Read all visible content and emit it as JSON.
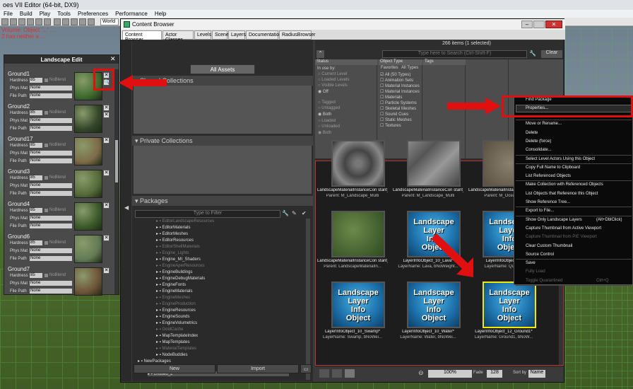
{
  "window": {
    "title": "oes VII Editor (64-bit, DX9)"
  },
  "menubar": [
    "File",
    "Build",
    "Play",
    "Tools",
    "Preferences",
    "Performance",
    "Help"
  ],
  "toolbar": {
    "world": "World"
  },
  "bg_errors": [
    "Volume: Object '...' ...",
    "2 has neither a ..."
  ],
  "landscape": {
    "title": "Landscape Edit",
    "layers": [
      {
        "name": "Ground1",
        "hardness": "85",
        "noblend": "NoBlend",
        "physmat": "None",
        "filepath": "None"
      },
      {
        "name": "Ground2",
        "hardness": "85",
        "noblend": "NoBlend",
        "physmat": "None",
        "filepath": "None"
      },
      {
        "name": "Ground17",
        "hardness": "85",
        "noblend": "NoBlend",
        "physmat": "None",
        "filepath": "None"
      },
      {
        "name": "Ground3",
        "hardness": "85",
        "noblend": "NoBlend",
        "physmat": "None",
        "filepath": "None"
      },
      {
        "name": "Ground4",
        "hardness": "85",
        "noblend": "NoBlend",
        "physmat": "None",
        "filepath": "None"
      },
      {
        "name": "Ground6",
        "hardness": "85",
        "noblend": "NoBlend",
        "physmat": "None",
        "filepath": "None"
      },
      {
        "name": "Ground7",
        "hardness": "85",
        "noblend": "NoBlend",
        "physmat": "None",
        "filepath": "None"
      }
    ],
    "labels": {
      "hardness": "Hardness",
      "physmat": "Phys Mat",
      "filepath": "File Path"
    }
  },
  "browser": {
    "title": "Content Browser",
    "tabs": [
      "Content Browser",
      "Actor Classes",
      "Levels",
      "Scene",
      "Layers",
      "Documentation",
      "RadiusBrowser"
    ],
    "all_assets": "All Assets",
    "shared": "Shared Collections",
    "private": "Private Collections",
    "packages": "Packages",
    "pkg_filter": "Type to Filter",
    "items_count": "266 items (1 selected)",
    "search_placeholder": "Type here to Search (Ctrl-Shift-F)",
    "clear": "Clear",
    "new": "New",
    "import": "Import",
    "zoom": "100%",
    "thumb_size": "128",
    "sort_by": "Sort by",
    "sort_value": "Name",
    "fade": "Fade"
  },
  "packages": [
    {
      "name": "EditorLandscapeResources",
      "dim": true
    },
    {
      "name": "EditorMaterials",
      "dim": false
    },
    {
      "name": "EditorMeshes",
      "dim": false
    },
    {
      "name": "EditorResources",
      "dim": false
    },
    {
      "name": "EditorShellMaterials",
      "dim": true
    },
    {
      "name": "Engine_Lights",
      "dim": true
    },
    {
      "name": "Engine_MI_Shaders",
      "dim": false
    },
    {
      "name": "EngineAperResources",
      "dim": true
    },
    {
      "name": "EngineBuildings",
      "dim": false
    },
    {
      "name": "EngineDebugMaterials",
      "dim": false
    },
    {
      "name": "EngineFonts",
      "dim": false
    },
    {
      "name": "EngineMaterials",
      "dim": false
    },
    {
      "name": "EngineMeshes",
      "dim": true
    },
    {
      "name": "EngineProduction",
      "dim": true
    },
    {
      "name": "EngineResources",
      "dim": false
    },
    {
      "name": "EngineSounds",
      "dim": false
    },
    {
      "name": "EngineVolumetrics",
      "dim": false
    },
    {
      "name": "GoldCache",
      "dim": true
    },
    {
      "name": "MapTemplateIndex",
      "dim": false
    },
    {
      "name": "MapTemplates",
      "dim": false
    },
    {
      "name": "MaterialTemplates",
      "dim": true
    },
    {
      "name": "NodeBuddies",
      "dim": false
    },
    {
      "name": "NewPackages",
      "dim": false
    },
    {
      "name": "Untitled_1",
      "dim": false
    },
    {
      "name": "Untitled_2*",
      "dim": false
    }
  ],
  "filters": {
    "status_hdr": "Status",
    "inuse": "In use by:",
    "status": [
      "Current Level",
      "Loaded Levels",
      "Visible Levels",
      "Off",
      "Tagged",
      "Untagged",
      "Both",
      "Loaded",
      "Unloaded",
      "Both"
    ],
    "type_hdr": "Object Type",
    "type_sub": [
      "Favorites",
      "All Types"
    ],
    "types": [
      "All (50 Types)",
      "Animation Sets",
      "Material Instances",
      "Material Instances",
      "Materials",
      "Particle Systems",
      "Skeletal Meshes",
      "Sound Cues",
      "Static Meshes",
      "Textures"
    ],
    "tags_hdr": "Tags"
  },
  "assets": [
    {
      "name": "LandscapeMaterialInstanceCon stant_86*",
      "parent": "Parent: M_Landscape_Multi",
      "kind": "rock"
    },
    {
      "name": "LandscapeMaterialInstanceCon stant_87*",
      "parent": "Parent: M_Landscape_Multi",
      "kind": "stone"
    },
    {
      "name": "LandscapeMaterialInstanceCon stant_88*",
      "parent": "Parent: M_OceanL...",
      "kind": "dirt"
    },
    {
      "name": "LandscapeMaterialInstanceCon stant_9*",
      "parent": "Parent: LandscapeMaterialIn...",
      "kind": "grass"
    },
    {
      "name": "LayerInfoObject_10_Lava*",
      "parent": "LayerName: Lava, bNoWeight...",
      "kind": "lio"
    },
    {
      "name": "LayerInfoObject_...",
      "parent": "LayerName: Quick...",
      "kind": "lio"
    },
    {
      "name": "LayerInfoObject_10_Swamp*",
      "parent": "LayerName: Swamp, bNoWei...",
      "kind": "lio"
    },
    {
      "name": "LayerInfoObject_10_Water*",
      "parent": "LayerName: Water, bNoWei...",
      "kind": "lio"
    },
    {
      "name": "LayerInfoObject_12_Ground1*",
      "parent": "LayerName: Ground1, bNoW...",
      "kind": "lio",
      "selected": true
    }
  ],
  "lio_text": [
    "Landscape",
    "Layer",
    "Info",
    "Object"
  ],
  "context_menu": [
    {
      "label": "Find Package"
    },
    {
      "label": "Properties...",
      "highlight": true
    },
    {
      "label": "Move or Rename..."
    },
    {
      "label": "Delete"
    },
    {
      "label": "Delete (force)"
    },
    {
      "label": "Consolidate..."
    },
    {
      "label": "Select Level Actors Using this Object"
    },
    {
      "label": "Copy Full Name to Clipboard"
    },
    {
      "label": "List Referenced Objects"
    },
    {
      "label": "Make Collection with Referenced Objects"
    },
    {
      "label": "List Objects that Reference this Object"
    },
    {
      "label": "Show Reference Tree..."
    },
    {
      "label": "Export to File..."
    },
    {
      "label": "Show Only Landscape Layers",
      "shortcut": "(Alt+DblClick)"
    },
    {
      "label": "Capture Thumbnail from Active Viewport"
    },
    {
      "label": "Capture Thumbnail from PIE Viewport",
      "dim": true
    },
    {
      "label": "Clear Custom Thumbnail"
    },
    {
      "label": "Source Control"
    },
    {
      "label": "Save"
    },
    {
      "label": "Fully Load",
      "dim": true
    },
    {
      "label": "Toggle Quarantined",
      "shortcut": "Ctrl+Q",
      "dim": true
    }
  ],
  "colors": {
    "annotation": "#e01010",
    "selected": "#f5e700",
    "highlight": "#1e1e1e"
  }
}
